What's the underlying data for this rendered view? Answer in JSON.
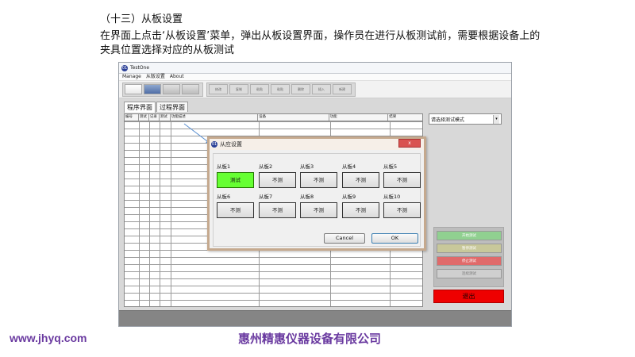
{
  "slide": {
    "heading": "（十三）从板设置",
    "paragraph": "在界面上点击‘从板设置’菜单，弹出从板设置界面，操作员在进行从板测试前，需要根据设备上的夹具位置选择对应的从板测试",
    "footer_url": "www.jhyq.com",
    "footer_company": "惠州精惠仪器设备有限公司"
  },
  "app": {
    "title": "TestOne",
    "icon_text": "01",
    "menus": [
      "Manage",
      "从版设置",
      "About"
    ],
    "toolbar_buttons": [
      "修改",
      "复制",
      "粘贴",
      "粘贴",
      "删除",
      "插入",
      "新建"
    ],
    "tabs": [
      "程序界面",
      "过程界面"
    ],
    "grid_columns": [
      "编号",
      "测试",
      "记录",
      "测试",
      "功能描述",
      "设备",
      "功能",
      "结果"
    ],
    "mode_select": "请选择测试模式",
    "controls": [
      "开始测试",
      "暂停测试",
      "停止测试",
      "连续测试"
    ],
    "exit_label": "退出",
    "colors": {
      "exit": "#ee0000",
      "test_on": "#66ff33",
      "brand_purple": "#6a3aa0"
    }
  },
  "dialog": {
    "title": "从应设置",
    "close_label": "x",
    "slaves": [
      {
        "label": "从板1",
        "state": "测试"
      },
      {
        "label": "从板2",
        "state": "不测"
      },
      {
        "label": "从板3",
        "state": "不测"
      },
      {
        "label": "从板4",
        "state": "不测"
      },
      {
        "label": "从板5",
        "state": "不测"
      },
      {
        "label": "从板6",
        "state": "不测"
      },
      {
        "label": "从板7",
        "state": "不测"
      },
      {
        "label": "从板8",
        "state": "不测"
      },
      {
        "label": "从板9",
        "state": "不测"
      },
      {
        "label": "从板10",
        "state": "不测"
      }
    ],
    "cancel_label": "Cancel",
    "ok_label": "OK"
  }
}
